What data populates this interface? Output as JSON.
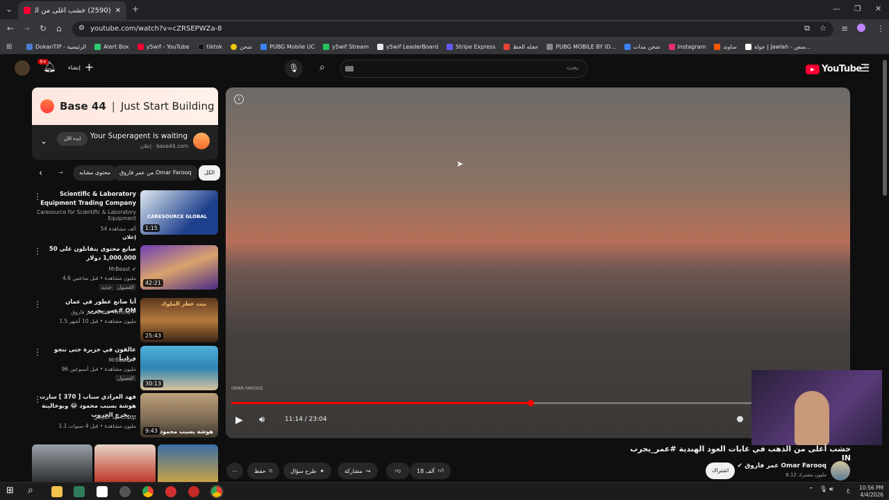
{
  "browser": {
    "tab_title": "(2590) خشب أغلى من الذهب في",
    "url": "youtube.com/watch?v=cZRSEPWZa-8"
  },
  "bookmarks": [
    {
      "label": "DokanTIP - الرئيسية",
      "color": "#4a7bd0"
    },
    {
      "label": "Alert Box",
      "color": "#2ecc71"
    },
    {
      "label": "y5wif - YouTube",
      "color": "#ff0033"
    },
    {
      "label": "tiktok",
      "color": "#111111"
    },
    {
      "label": "شحن",
      "color": "#f1c40f"
    },
    {
      "label": "PUBG Mobile UC",
      "color": "#3b82f6"
    },
    {
      "label": "y5wif Stream",
      "color": "#22c55e"
    },
    {
      "label": "y5wif LeaderBoard",
      "color": "#e5e7eb"
    },
    {
      "label": "Stripe Express",
      "color": "#635bff"
    },
    {
      "label": "عجله الحظ",
      "color": "#ea4335"
    },
    {
      "label": "PUBG MOBILE BY ID...",
      "color": "#888888"
    },
    {
      "label": "شحن مدات",
      "color": "#3b82f6"
    },
    {
      "label": "Instagram",
      "color": "#e1306c"
    },
    {
      "label": "ساوند",
      "color": "#ff5500"
    },
    {
      "label": "جولة | Jawlah - منص...",
      "color": "#ffffff"
    }
  ],
  "yt": {
    "create_label": "إنشاء",
    "notif_count": "9+",
    "search_placeholder": "بحث",
    "logo": "YouTube",
    "logo_region": "AE"
  },
  "ad": {
    "brand": "Base 44",
    "tagline": "Just Start Building",
    "headline": "Your Superagent is waiting",
    "sponsor": "إعلان",
    "domain": "base44.com",
    "cta": "ابدء الآن"
  },
  "chips": {
    "all": "الكل",
    "from": "من عمر فاروق Omar Farooq",
    "related": "محتوى مشابه"
  },
  "recs": [
    {
      "title": "Scientific & Laboratory Equipment Trading Company",
      "channel": "Caresource for Scientific & Laboratory Equipment",
      "views": "54 ألف مشاهدة",
      "badge": "إعلان",
      "duration": "1:15",
      "thumb_text": "CARESOURCE GLOBAL"
    },
    {
      "title": "50 صانع محتوى يتقاتلون على 1,000,000 دولار",
      "channel": "MrBeast",
      "views": "4.6 مليون مشاهدة • قبل ساعتين",
      "badge": "جديد",
      "badge2": "الفصول",
      "duration": "42:21"
    },
    {
      "title": "أنا صانع عطور في عمان #عمر_يجرب OM",
      "channel": "عمر فاروق Omar Farooq",
      "views": "1.5 مليون مشاهدة • قبل 10 أشهر",
      "duration": "25:43",
      "thumb_text": "بيت عطر الملوك"
    },
    {
      "title": "عالقون في جزيرة حتى ننجو فرادياً",
      "channel": "MrBeast",
      "views": "96 مليون مشاهدة • قبل أسبوعين",
      "badge2": "الفصول",
      "duration": "30:13"
    },
    {
      "title": "فهد العرادي سناب [ 370 ] سارت هوشة بسبب محمود 😂 وبوخالينة يخرج الجروب...",
      "channel": "يوميات فهد العرادي",
      "views": "1.1 مليون مشاهدة • قبل 4 سنوات",
      "duration": "9:43",
      "thumb_text": "هوشة بسبب محمود"
    }
  ],
  "player": {
    "time": "11:14 / 23:04",
    "progress": 0.487,
    "watermark": "OMAR FAROOQ"
  },
  "video": {
    "title": "خشب أغلى من الذهب في غابات العود الهندية #عمر_يجرب IN",
    "channel": "عمر فاروق Omar Farooq",
    "subs": "8.12 مليون مشترك",
    "subscribe": "اشتراك",
    "likes": "18 ألف",
    "share": "مشاركة",
    "ask": "طرح سؤال",
    "save": "حفظ"
  },
  "clock": {
    "time": "10:56 PM",
    "date": "4/4/2026",
    "lang": "ع"
  }
}
